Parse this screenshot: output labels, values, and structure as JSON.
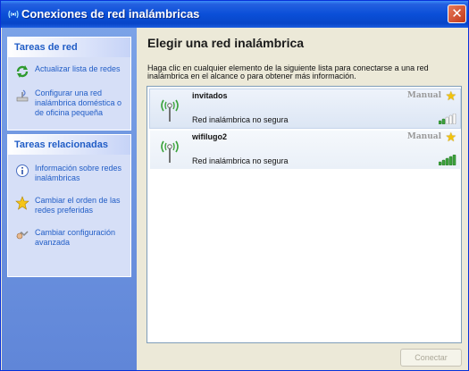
{
  "window": {
    "title": "Conexiones de red inalámbricas",
    "close_glyph": "✕"
  },
  "left_pane": {
    "network_tasks": {
      "heading": "Tareas de red",
      "items": [
        {
          "label": "Actualizar lista de redes",
          "icon": "refresh-icon"
        },
        {
          "label": "Configurar una red inalámbrica doméstica o de oficina pequeña",
          "icon": "wireless-setup-icon"
        }
      ]
    },
    "related_tasks": {
      "heading": "Tareas relacionadas",
      "items": [
        {
          "label": "Información sobre redes inalámbricas",
          "icon": "info-icon"
        },
        {
          "label": "Cambiar el orden de las redes preferidas",
          "icon": "star-icon"
        },
        {
          "label": "Cambiar configuración avanzada",
          "icon": "advanced-settings-icon"
        }
      ]
    }
  },
  "main": {
    "heading": "Elegir una red inalámbrica",
    "description": "Haga clic en cualquier elemento de la siguiente lista para conectarse a una red inalámbrica en el alcance o para obtener más información.",
    "networks": [
      {
        "ssid": "invitados",
        "security": "Red inalámbrica no segura",
        "mode": "Manual",
        "signal_bars": 2,
        "selected": true
      },
      {
        "ssid": "wifilugo2",
        "security": "Red inalámbrica no segura",
        "mode": "Manual",
        "signal_bars": 5,
        "selected": false
      }
    ],
    "connect_button": "Conectar"
  },
  "colors": {
    "title_bar": "#0a4fd8",
    "task_link": "#215dc6",
    "signal_on": "#3ca33c",
    "signal_off": "#c8c8c8",
    "star": "#f2c30c"
  }
}
